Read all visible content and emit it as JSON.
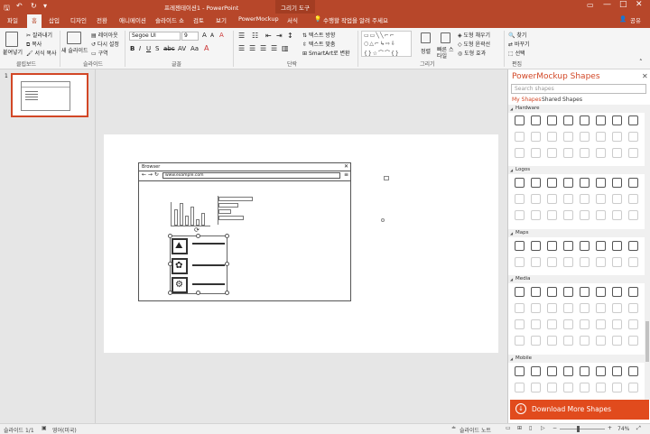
{
  "window": {
    "title": "프레젠테이션1 - PowerPoint",
    "contextual_tab": "그리기 도구",
    "user": "공유"
  },
  "tabs": [
    {
      "label": "파일"
    },
    {
      "label": "홈"
    },
    {
      "label": "삽입"
    },
    {
      "label": "디자인"
    },
    {
      "label": "전환"
    },
    {
      "label": "애니메이션"
    },
    {
      "label": "슬라이드 쇼"
    },
    {
      "label": "검토"
    },
    {
      "label": "보기"
    },
    {
      "label": "PowerMockup"
    },
    {
      "label": "서식"
    }
  ],
  "tell_me": "수행할 작업을 알려 주세요",
  "ribbon": {
    "clipboard": {
      "paste": "붙여넣기",
      "cut": "잘라내기",
      "copy": "복사",
      "format_painter": "서식 복사",
      "group": "클립보드"
    },
    "slides": {
      "new_slide": "새 슬라이드",
      "layout": "레이아웃",
      "reset": "다시 설정",
      "section": "구역",
      "group": "슬라이드"
    },
    "font": {
      "font_name": "Segoe UI",
      "font_size": "9",
      "group": "글꼴"
    },
    "paragraph": {
      "text_direction": "텍스트 방향",
      "align_text": "텍스트 맞춤",
      "smartart": "SmartArt로 변환",
      "group": "단락"
    },
    "drawing": {
      "arrange": "정렬",
      "quick_styles": "빠른 스타일",
      "shape_fill": "도형 채우기",
      "shape_outline": "도형 윤곽선",
      "shape_effects": "도형 효과",
      "group": "그리기"
    },
    "editing": {
      "find": "찾기",
      "replace": "바꾸기",
      "select": "선택",
      "group": "편집"
    }
  },
  "thumbnail": {
    "number": "1"
  },
  "mockup": {
    "browser_title": "Browser",
    "url": "www.example.com"
  },
  "pane": {
    "title": "PowerMockup Shapes",
    "search_placeholder": "Search shapes",
    "tab_my": "My Shapes",
    "tab_shared": "Shared Shapes",
    "sections": [
      "Hardware",
      "Logos",
      "Maps",
      "Media",
      "Mobile"
    ],
    "download": "Download More Shapes"
  },
  "status": {
    "slide": "슬라이드 1/1",
    "language": "영어(미국)",
    "notes": "슬라이드 노트",
    "zoom": "74%"
  },
  "colors": {
    "accent": "#b7472a",
    "pane_accent": "#d24726",
    "download_bg": "#e14b1d"
  }
}
